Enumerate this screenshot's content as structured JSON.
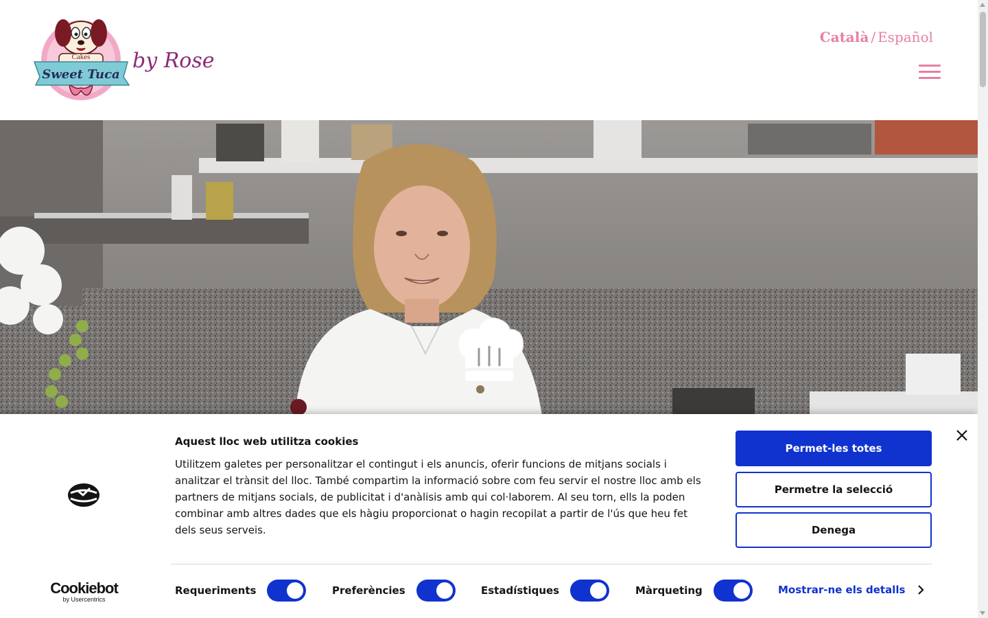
{
  "header": {
    "logo_text_top": "Cakes",
    "logo_text_main": "Sweet Tuca",
    "logo_tagline": "by Rose",
    "lang_active": "Català",
    "lang_separator": "/",
    "lang_other": "Español"
  },
  "cookie": {
    "title": "Aquest lloc web utilitza cookies",
    "body": "Utilitzem galetes per personalitzar el contingut i els anuncis, oferir funcions de mitjans socials i analitzar el trànsit del lloc. També compartim la informació sobre com feu servir el nostre lloc amb els partners de mitjans socials, de publicitat i d'anàlisis amb qui col·laborem. Al seu torn, ells la poden combinar amb altres dades que els hàgiu proporcionat o hagin recopilat a partir de l'ús que heu fet dels seus serveis.",
    "allow_all": "Permet-les totes",
    "allow_selection": "Permetre la selecció",
    "deny": "Denega",
    "brand": "Cookiebot",
    "brand_sub": "by Usercentrics",
    "toggles": [
      {
        "label": "Requeriments",
        "on": true
      },
      {
        "label": "Preferències",
        "on": true
      },
      {
        "label": "Estadístiques",
        "on": true
      },
      {
        "label": "Màrqueting",
        "on": true
      }
    ],
    "show_details": "Mostrar-ne els detalls"
  },
  "colors": {
    "accent_pink": "#e77fa6",
    "cookie_blue": "#1032cf",
    "tagline_purple": "#8c2a7a"
  }
}
